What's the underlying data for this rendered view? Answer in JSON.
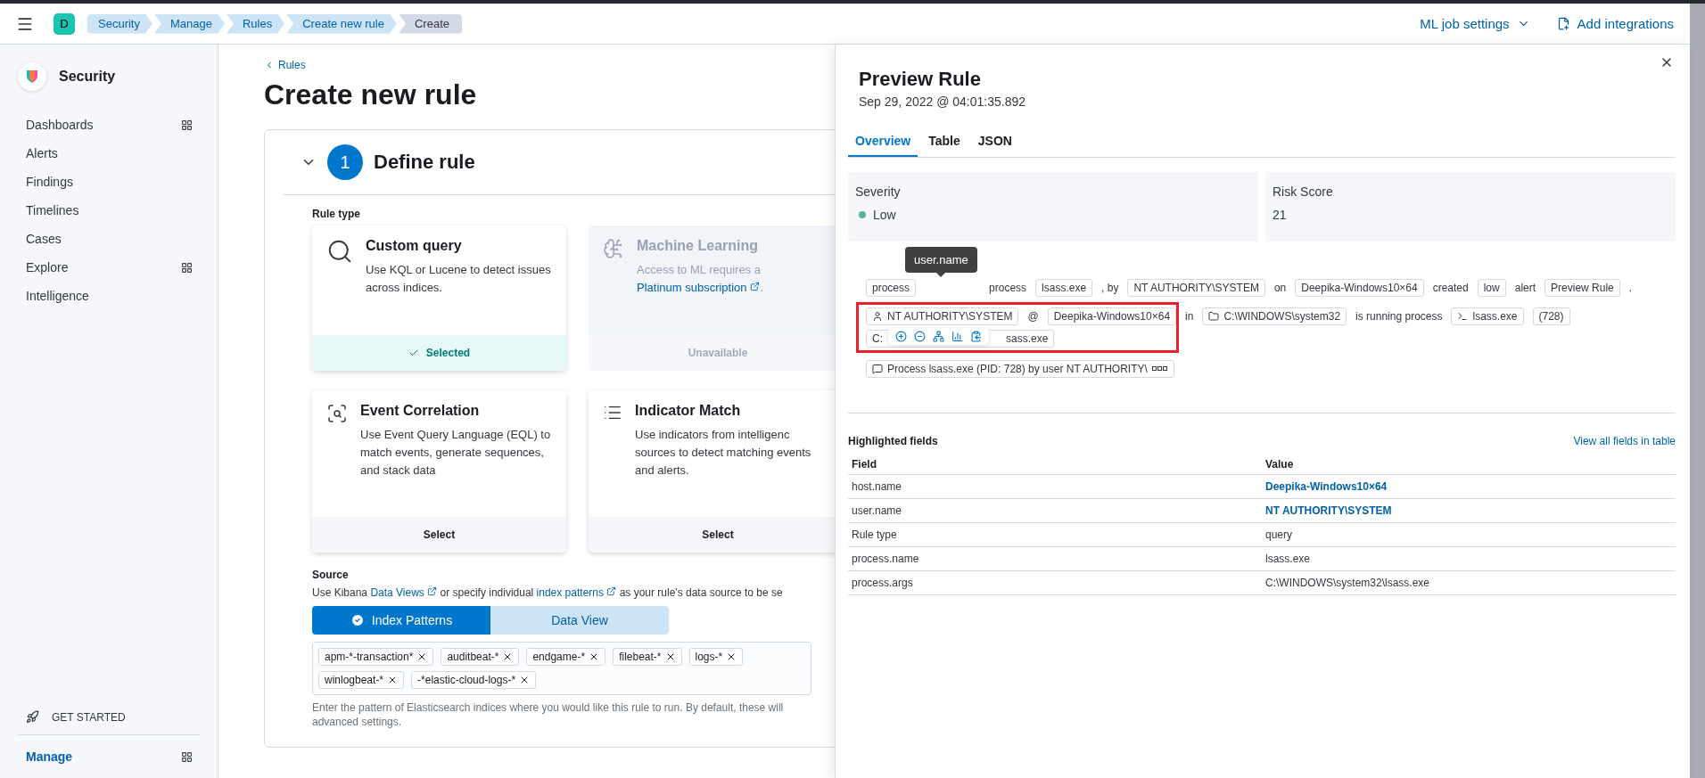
{
  "topbar": {
    "avatar": "D",
    "breadcrumbs": [
      {
        "label": "Security",
        "selected": false
      },
      {
        "label": "Manage",
        "selected": false
      },
      {
        "label": "Rules",
        "selected": false
      },
      {
        "label": "Create new rule",
        "selected": false
      },
      {
        "label": "Create",
        "selected": true
      }
    ],
    "actions": [
      {
        "label": "ML job settings",
        "kind": "dropdown"
      },
      {
        "label": "Add integrations",
        "kind": "add"
      }
    ]
  },
  "sidebar": {
    "title": "Security",
    "items": [
      {
        "label": "Dashboards",
        "grid_icon": true
      },
      {
        "label": "Alerts",
        "grid_icon": false
      },
      {
        "label": "Findings",
        "grid_icon": false
      },
      {
        "label": "Timelines",
        "grid_icon": false
      },
      {
        "label": "Cases",
        "grid_icon": false
      },
      {
        "label": "Explore",
        "grid_icon": true
      },
      {
        "label": "Intelligence",
        "grid_icon": false
      }
    ],
    "get_started": "GET STARTED",
    "manage": "Manage"
  },
  "main": {
    "back_link": "Rules",
    "title": "Create new rule",
    "step": {
      "number": "1",
      "title": "Define rule",
      "expanded": true
    },
    "rule_type_label": "Rule type",
    "cards": [
      {
        "kind": "query",
        "title": "Custom query",
        "description": [
          {
            "kind": "text",
            "text": "Use KQL or Lucene to detect issues across indices."
          }
        ],
        "footer": "Selected",
        "selected": true,
        "disabled": false
      },
      {
        "kind": "ml",
        "title": "Machine Learning",
        "description": [
          {
            "kind": "text",
            "text": "Access to ML requires a "
          },
          {
            "kind": "link",
            "text": "Platinum subscription"
          },
          {
            "kind": "text",
            "text": "."
          }
        ],
        "footer": "Unavailable",
        "selected": false,
        "disabled": true
      },
      {
        "kind": "eql",
        "title": "Event Correlation",
        "description": [
          {
            "kind": "text",
            "text": "Use Event Query Language (EQL) to match events, generate sequences, and stack data"
          }
        ],
        "footer": "Select",
        "selected": false,
        "disabled": false
      },
      {
        "kind": "threat",
        "title": "Indicator Match",
        "description": [
          {
            "kind": "text",
            "text": "Use indicators from intelligenc sources to detect matching events and alerts."
          }
        ],
        "footer": "Select",
        "selected": false,
        "disabled": false
      }
    ],
    "source": {
      "label": "Source",
      "help": [
        {
          "kind": "text",
          "text": "Use Kibana "
        },
        {
          "kind": "link",
          "text": "Data Views"
        },
        {
          "kind": "text",
          "text": " or specify individual "
        },
        {
          "kind": "link",
          "text": "index patterns"
        },
        {
          "kind": "text",
          "text": " as your rule's data source to be se"
        }
      ],
      "toggle": [
        {
          "label": "Index Patterns",
          "selected": true
        },
        {
          "label": "Data View",
          "selected": false
        }
      ],
      "patterns": [
        "apm-*-transaction*",
        "auditbeat-*",
        "endgame-*",
        "filebeat-*",
        "logs-*",
        "winlogbeat-*",
        "-*elastic-cloud-logs-*"
      ],
      "note": [
        "Enter the pattern of Elasticsearch indices where you would like this rule to run. By default, these will",
        "advanced settings."
      ]
    }
  },
  "flyout": {
    "title": "Preview Rule",
    "timestamp": "Sep 29, 2022 @ 04:01:35.892",
    "tabs": [
      {
        "label": "Overview",
        "selected": true
      },
      {
        "label": "Table",
        "selected": false
      },
      {
        "label": "JSON",
        "selected": false
      }
    ],
    "severity": {
      "label": "Severity",
      "value": "Low"
    },
    "risk": {
      "label": "Risk Score",
      "value": "21"
    },
    "tooltip": "user.name",
    "summary_rows": [
      [
        {
          "kind": "chip",
          "text": "process"
        },
        {
          "kind": "gap"
        },
        {
          "kind": "word",
          "text": "process"
        },
        {
          "kind": "chip",
          "text": "lsass.exe"
        },
        {
          "kind": "word",
          "text": ", by"
        },
        {
          "kind": "chip",
          "text": "NT AUTHORITY\\SYSTEM"
        },
        {
          "kind": "word",
          "text": "on"
        },
        {
          "kind": "chip",
          "text": "Deepika-Windows10×64"
        },
        {
          "kind": "word",
          "text": "created"
        },
        {
          "kind": "chip",
          "text": "low"
        },
        {
          "kind": "word",
          "text": "alert"
        },
        {
          "kind": "chip",
          "text": "Preview Rule"
        },
        {
          "kind": "word",
          "text": "."
        }
      ],
      [
        {
          "kind": "user-chip",
          "text": "NT AUTHORITY\\SYSTEM"
        },
        {
          "kind": "word",
          "text": "@"
        },
        {
          "kind": "chip",
          "text": "Deepika-Windows10×64"
        },
        {
          "kind": "word",
          "text": "in"
        },
        {
          "kind": "folder-chip",
          "text": "C:\\WINDOWS\\system32"
        },
        {
          "kind": "word",
          "text": "is running process"
        },
        {
          "kind": "process-chip",
          "text": "lsass.exe"
        },
        {
          "kind": "chip",
          "text": "(728)"
        }
      ],
      [
        {
          "kind": "covered-chip",
          "parts": [
            "C:",
            "sass.exe"
          ]
        }
      ],
      [
        {
          "kind": "message-chip",
          "text": "Process lsass.exe (PID: 728) by user NT AUTHORITY\\"
        }
      ]
    ],
    "highlighted": {
      "title": "Highlighted fields",
      "link": "View all fields in table",
      "columns": [
        "Field",
        "Value"
      ],
      "rows": [
        {
          "field": "host.name",
          "value": "Deepika-Windows10×64",
          "link": true
        },
        {
          "field": "user.name",
          "value": "NT AUTHORITY\\SYSTEM",
          "link": true
        },
        {
          "field": "Rule type",
          "value": "query",
          "link": false
        },
        {
          "field": "process.name",
          "value": "lsass.exe",
          "link": false
        },
        {
          "field": "process.args",
          "value": "C:\\WINDOWS\\system32\\lsass.exe",
          "link": false
        }
      ]
    }
  }
}
